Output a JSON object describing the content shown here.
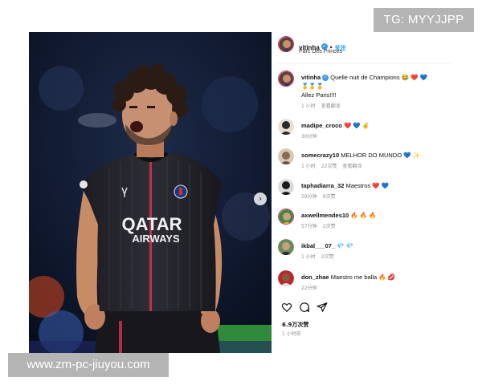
{
  "watermarks": {
    "telegram": "TG: MYYJJPP",
    "site_url": "www.zm-pc-jiuyou.com"
  },
  "photo": {
    "jersey_text_line1": "QATAR",
    "jersey_text_line2": "AIRWAYS"
  },
  "post": {
    "author": "vitinha",
    "follow_label": "关注",
    "separator": "•",
    "location": "Parc Des Princes",
    "likes": "6.9万次赞",
    "posted_time": "1 小时前"
  },
  "comments": [
    {
      "user": "vitinha",
      "text": "Quelle nuit de Champions 😂 ❤️ 💙",
      "text2": "🥇🥇🥇",
      "text3": "Allez Paris!!!!",
      "time": "1 小时",
      "likes": "",
      "translate": "查看翻译"
    },
    {
      "user": "madipe_croco",
      "text": "❤️ 💙 ✌️",
      "time": "30分钟",
      "likes": "",
      "translate": ""
    },
    {
      "user": "somecrazy10",
      "text": "MELHOR DO MUNDO 💙 ✨",
      "time": "1 小时",
      "likes": "22次赞",
      "translate": "查看翻译"
    },
    {
      "user": "taphadiarra_32",
      "text": "Maestros ❤️ 💙",
      "time": "59分钟",
      "likes": "9次赞",
      "translate": ""
    },
    {
      "user": "axwellmendes10",
      "text": "🔥 🔥 🔥",
      "time": "57分钟",
      "likes": "2次赞",
      "translate": ""
    },
    {
      "user": "ikbal___07_",
      "text": "💎 💎",
      "time": "1 小时",
      "likes": "2次赞",
      "translate": ""
    },
    {
      "user": "don_zhae",
      "text": "Maestro me balla 🔥 💋",
      "time": "22分钟",
      "likes": "",
      "translate": ""
    }
  ],
  "icons": [
    "verified-badge-icon",
    "heart-icon",
    "comment-icon",
    "share-icon",
    "next-arrow-icon"
  ],
  "colors": {
    "accent": "#0095f6",
    "verified": "#3897f0",
    "story_ring": "#d9317a",
    "meta_gray": "#8e8e8e",
    "watermark": "#b4b4b4"
  }
}
